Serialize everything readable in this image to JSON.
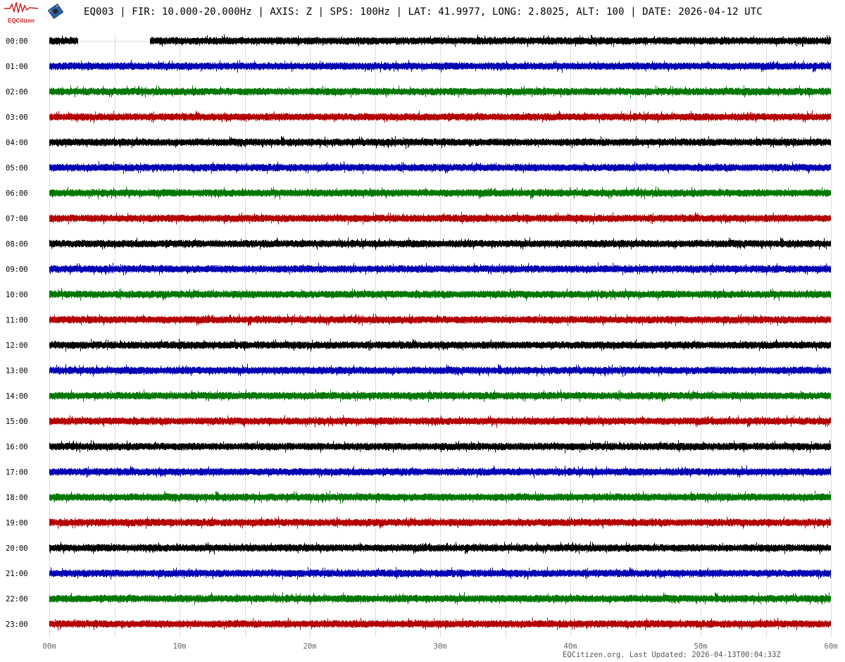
{
  "header": {
    "logo_text": "EQCitizen",
    "title": "EQ003 | FIR: 10.000-20.000Hz | AXIS: Z | SPS: 100Hz | LAT: 41.9977, LONG: 2.8025, ALT: 100 | DATE: 2026-04-12 UTC"
  },
  "footer": {
    "text": "EQCitizen.org. Last Updated: 2026-04-13T00:04:33Z"
  },
  "chart_data": {
    "type": "line",
    "subtype": "helicorder",
    "grid": true,
    "x_ticks": [
      "00m",
      "10m",
      "20m",
      "30m",
      "40m",
      "50m",
      "60m"
    ],
    "xlim": [
      0,
      60
    ],
    "x_grid_step_minutes": 5,
    "rows": [
      "00:00",
      "01:00",
      "02:00",
      "03:00",
      "04:00",
      "05:00",
      "06:00",
      "07:00",
      "08:00",
      "09:00",
      "10:00",
      "11:00",
      "12:00",
      "13:00",
      "14:00",
      "15:00",
      "16:00",
      "17:00",
      "18:00",
      "19:00",
      "20:00",
      "21:00",
      "22:00",
      "23:00"
    ],
    "row_colors": [
      "#000000",
      "#0000b4",
      "#007800",
      "#b40000"
    ],
    "data_gaps": [
      {
        "row": "00:00",
        "from_minute": 2.2,
        "to_minute": 7.7
      }
    ]
  }
}
